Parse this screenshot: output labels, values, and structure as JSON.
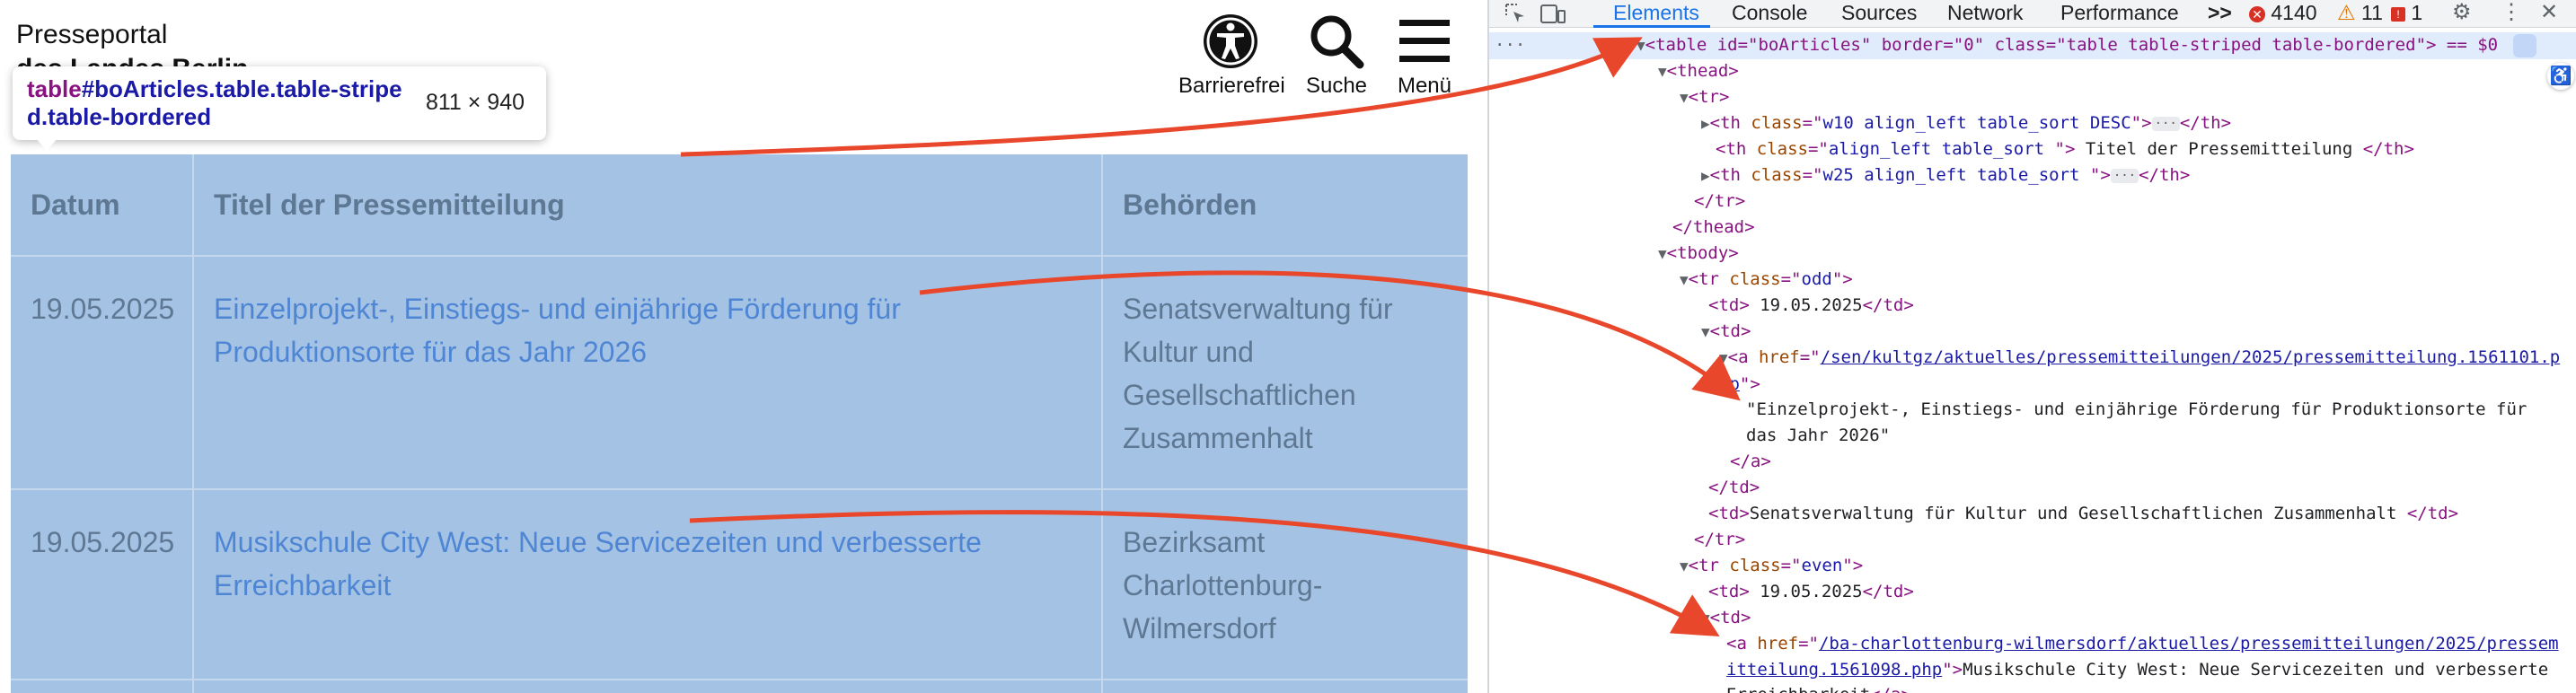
{
  "site": {
    "title": "Presseportal",
    "subtitle": "des Landes Berlin"
  },
  "nav": {
    "accessibility": "Barrierefrei",
    "search": "Suche",
    "menu": "Menü"
  },
  "tooltip": {
    "tag": "table",
    "selector": "#boArticles.table.table-striped.table-bordered",
    "dimensions": "811 × 940"
  },
  "table": {
    "headers": [
      "Datum",
      "Titel der Pressemitteilung",
      "Behörden"
    ],
    "rows": [
      {
        "date": "19.05.2025",
        "title": "Einzelprojekt-, Einstiegs- und einjährige Förderung für Produktionsorte für das Jahr 2026",
        "authority": "Senatsverwaltung für Kultur und Gesellschaftlichen Zusammenhalt"
      },
      {
        "date": "19.05.2025",
        "title": "Musikschule City West: Neue Servicezeiten und verbesserte Erreichbarkeit",
        "authority": "Bezirksamt Charlottenburg-Wilmersdorf"
      }
    ]
  },
  "devtools": {
    "tabs": [
      "Elements",
      "Console",
      "Sources",
      "Network",
      "Performance"
    ],
    "more": ">>",
    "errors": "4140",
    "warnings": "11",
    "issues": "1",
    "dom": {
      "table_open": "<table id=\"boArticles\" border=\"0\" class=\"table table-striped table-bordered\"> == $0",
      "thead": "<thead>",
      "tr": "<tr>",
      "th1_class": "w10 align_left table_sort DESC",
      "th2_class": "align_left table_sort ",
      "th2_text": " Titel der Pressemitteilung ",
      "th3_class": "w25 align_left table_sort ",
      "tr_close": "</tr>",
      "thead_close": "</thead>",
      "tbody": "<tbody>",
      "row1_class": "odd",
      "row1_date": " 19.05.2025",
      "row1_href": "/sen/kultgz/aktuelles/pressemitteilungen/2025/pressemitteilung.1561101.php",
      "row1_text": "\"Einzelprojekt-, Einstiegs- und einjährige Förderung für Produktionsorte für das Jahr 2026\"",
      "row1_authority": "Senatsverwaltung für Kultur und Gesellschaftlichen Zusammenhalt ",
      "row2_class": "even",
      "row2_date": " 19.05.2025",
      "row2_href": "/ba-charlottenburg-wilmersdorf/aktuelles/pressemitteilungen/2025/pressemitteilung.1561098.php",
      "row2_text": "Musikschule City West: Neue Servicezeiten und verbesserte Erreichbarkeit"
    }
  },
  "colors": {
    "highlight": "#a4c2e4",
    "link": "#4f86d4",
    "annotation_arrow": "#e8472c",
    "devtools_accent": "#1a73e8"
  }
}
